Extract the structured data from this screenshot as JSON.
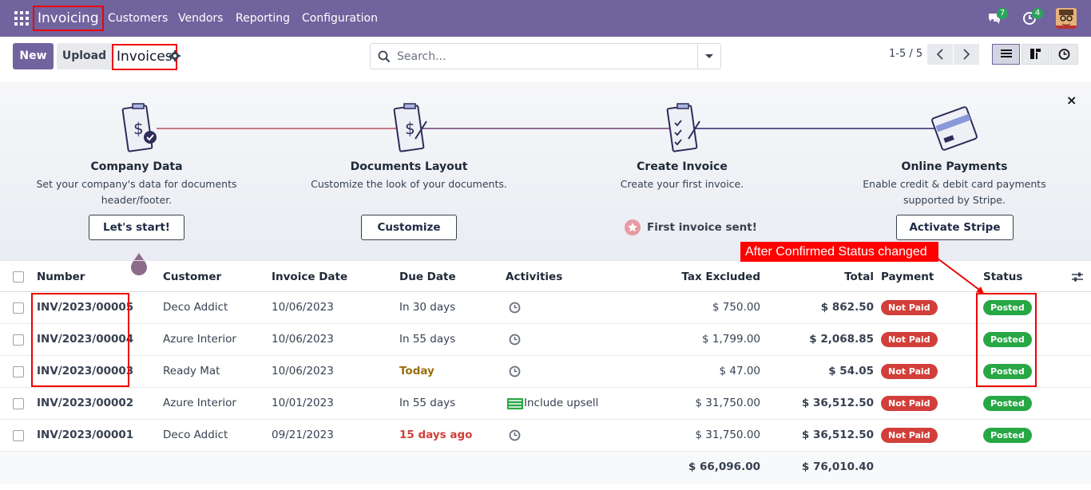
{
  "navbar": {
    "app_title": "Invoicing",
    "menus": [
      "Customers",
      "Vendors",
      "Reporting",
      "Configuration"
    ],
    "messages_count": "7",
    "activities_count": "4"
  },
  "control_panel": {
    "new_label": "New",
    "upload_label": "Upload",
    "breadcrumb": "Invoices",
    "search_placeholder": "Search...",
    "pager": "1-5 / 5"
  },
  "onboarding": {
    "steps": [
      {
        "title": "Company Data",
        "desc1": "Set your company's data for documents",
        "desc2": "header/footer.",
        "button": "Let's start!"
      },
      {
        "title": "Documents Layout",
        "desc1": "Customize the look of your documents.",
        "desc2": "",
        "button": "Customize"
      },
      {
        "title": "Create Invoice",
        "desc1": "Create your first invoice.",
        "desc2": "",
        "done": "First invoice sent!"
      },
      {
        "title": "Online Payments",
        "desc1": "Enable credit & debit card payments",
        "desc2": "supported by Stripe.",
        "button": "Activate Stripe"
      }
    ],
    "close": "×"
  },
  "table": {
    "headers": {
      "number": "Number",
      "customer": "Customer",
      "invoice_date": "Invoice Date",
      "due_date": "Due Date",
      "activities": "Activities",
      "tax_excluded": "Tax Excluded",
      "total": "Total",
      "payment": "Payment",
      "status": "Status"
    },
    "rows": [
      {
        "number": "INV/2023/00005",
        "customer": "Deco Addict",
        "invoice_date": "10/06/2023",
        "due_date": "In 30 days",
        "activity": "",
        "tax_excluded": "$ 750.00",
        "total": "$ 862.50",
        "payment": "Not Paid",
        "status": "Posted"
      },
      {
        "number": "INV/2023/00004",
        "customer": "Azure Interior",
        "invoice_date": "10/06/2023",
        "due_date": "In 55 days",
        "activity": "",
        "tax_excluded": "$ 1,799.00",
        "total": "$ 2,068.85",
        "payment": "Not Paid",
        "status": "Posted"
      },
      {
        "number": "INV/2023/00003",
        "customer": "Ready Mat",
        "invoice_date": "10/06/2023",
        "due_date": "Today",
        "activity": "",
        "tax_excluded": "$ 47.00",
        "total": "$ 54.05",
        "payment": "Not Paid",
        "status": "Posted"
      },
      {
        "number": "INV/2023/00002",
        "customer": "Azure Interior",
        "invoice_date": "10/01/2023",
        "due_date": "In 55 days",
        "activity": "Include upsell",
        "tax_excluded": "$ 31,750.00",
        "total": "$ 36,512.50",
        "payment": "Not Paid",
        "status": "Posted"
      },
      {
        "number": "INV/2023/00001",
        "customer": "Deco Addict",
        "invoice_date": "09/21/2023",
        "due_date": "15 days ago",
        "activity": "",
        "tax_excluded": "$ 31,750.00",
        "total": "$ 36,512.50",
        "payment": "Not Paid",
        "status": "Posted"
      }
    ],
    "totals": {
      "tax_excluded": "$ 66,096.00",
      "total": "$ 76,010.40"
    }
  },
  "annotation": {
    "label": "After Confirmed Status changed"
  }
}
